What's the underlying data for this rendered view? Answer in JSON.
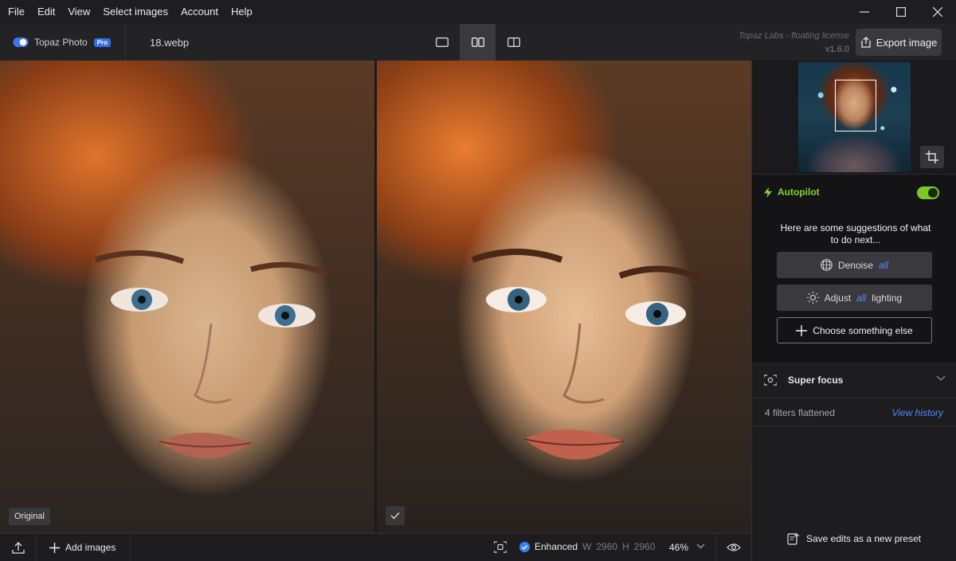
{
  "menu": {
    "items": [
      "File",
      "Edit",
      "View",
      "Select images",
      "Account",
      "Help"
    ]
  },
  "toolbar": {
    "brand": "Topaz Photo",
    "badge": "Pro",
    "filename": "18.webp",
    "license": "Topaz Labs - floating license",
    "version": "v1.6.0",
    "export_label": "Export image"
  },
  "canvas": {
    "original_label": "Original"
  },
  "sidebar": {
    "autopilot_title": "Autopilot",
    "autopilot_enabled": true,
    "hint": "Here are some suggestions of what to do next...",
    "suggestions": [
      {
        "prefix": "Denoise",
        "emph": "all",
        "suffix": ""
      },
      {
        "prefix": "Adjust",
        "emph": "all",
        "suffix": "lighting"
      }
    ],
    "choose_label": "Choose something else",
    "super_focus": "Super focus",
    "filters_flattened": "4 filters flattened",
    "view_history": "View history",
    "save_preset": "Save edits as a new preset"
  },
  "bottombar": {
    "add_images": "Add images",
    "status": "Enhanced",
    "w_label": "W",
    "w_value": "2960",
    "h_label": "H",
    "h_value": "2960",
    "zoom": "46%"
  },
  "colors": {
    "accent_green": "#86d42e",
    "accent_blue": "#4f8bff",
    "pro_badge": "#2f6fe8"
  }
}
